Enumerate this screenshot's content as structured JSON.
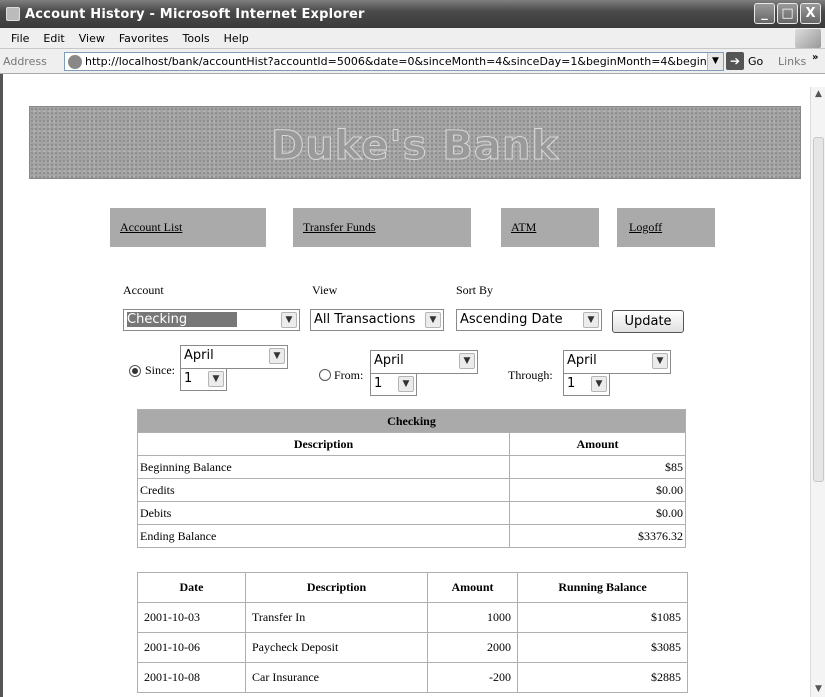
{
  "window": {
    "title": "Account History - Microsoft Internet Explorer",
    "minimize": "_",
    "maximize": "□",
    "close": "X"
  },
  "menu": [
    "File",
    "Edit",
    "View",
    "Favorites",
    "Tools",
    "Help"
  ],
  "address": {
    "label": "Address",
    "url": "http://localhost/bank/accountHist?accountId=5006&date=0&sinceMonth=4&sinceDay=1&beginMonth=4&beginDa",
    "go": "Go",
    "links": "Links"
  },
  "banner": {
    "title": "Duke's Bank"
  },
  "nav": [
    "Account List",
    "Transfer Funds",
    "ATM",
    "Logoff"
  ],
  "form": {
    "account_label": "Account",
    "account_value": "Checking",
    "view_label": "View",
    "view_value": "All Transactions",
    "sort_label": "Sort By",
    "sort_value": "Ascending Date",
    "update_button": "Update",
    "since_label": "Since:",
    "since_month": "April",
    "since_day": "1",
    "since_selected": true,
    "from_label": "From:",
    "from_month": "April",
    "from_day": "1",
    "through_label": "Through:",
    "through_month": "April",
    "through_day": "1"
  },
  "summary": {
    "caption": "Checking",
    "headers": [
      "Description",
      "Amount"
    ],
    "rows": [
      [
        "Beginning Balance",
        "$85"
      ],
      [
        "Credits",
        "$0.00"
      ],
      [
        "Debits",
        "$0.00"
      ],
      [
        "Ending Balance",
        "$3376.32"
      ]
    ]
  },
  "transactions": {
    "headers": [
      "Date",
      "Description",
      "Amount",
      "Running Balance"
    ],
    "rows": [
      [
        "2001-10-03",
        "Transfer In",
        "1000",
        "$1085"
      ],
      [
        "2001-10-06",
        "Paycheck Deposit",
        "2000",
        "$3085"
      ],
      [
        "2001-10-08",
        "Car Insurance",
        "-200",
        "$2885"
      ]
    ]
  },
  "icons": {
    "ie": "ie-icon",
    "windows": "windows-flag-icon",
    "go": "go-arrow-icon",
    "dropdown": "chevron-down-icon"
  }
}
